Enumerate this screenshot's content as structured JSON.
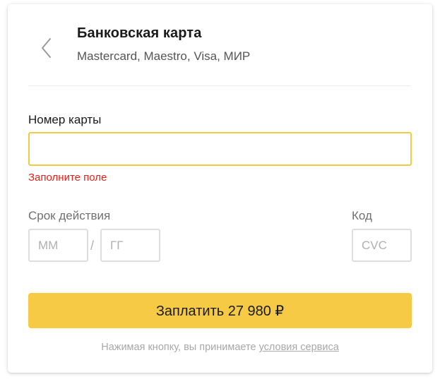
{
  "header": {
    "back_icon": "chevron-left-icon",
    "title": "Банковская карта",
    "subtitle": "Mastercard, Maestro, Visa, МИР"
  },
  "card_number": {
    "label": "Номер карты",
    "value": "",
    "error": "Заполните поле"
  },
  "expiry": {
    "label": "Срок действия",
    "month_placeholder": "ММ",
    "separator": "/",
    "year_placeholder": "ГГ"
  },
  "cvc": {
    "label": "Код",
    "placeholder": "CVC"
  },
  "pay_button": {
    "label": "Заплатить 27 980 ₽"
  },
  "footer": {
    "text": "Нажимая кнопку, вы принимаете ",
    "link": "условия сервиса"
  },
  "colors": {
    "accent": "#f6ca45",
    "focus_border": "#f4ca45",
    "error": "#e2231a"
  }
}
